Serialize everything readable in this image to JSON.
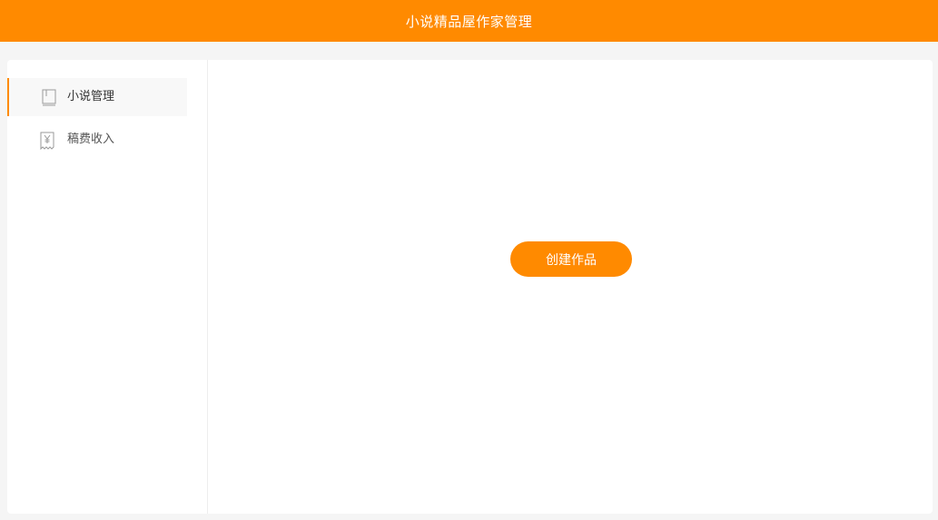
{
  "header": {
    "title": "小说精品屋作家管理",
    "color": "#ff8a00"
  },
  "sidebar": {
    "items": [
      {
        "label": "小说管理",
        "icon": "book-icon",
        "active": true
      },
      {
        "label": "稿费收入",
        "icon": "receipt-yen-icon",
        "active": false
      }
    ]
  },
  "main": {
    "create_button_label": "创建作品"
  }
}
